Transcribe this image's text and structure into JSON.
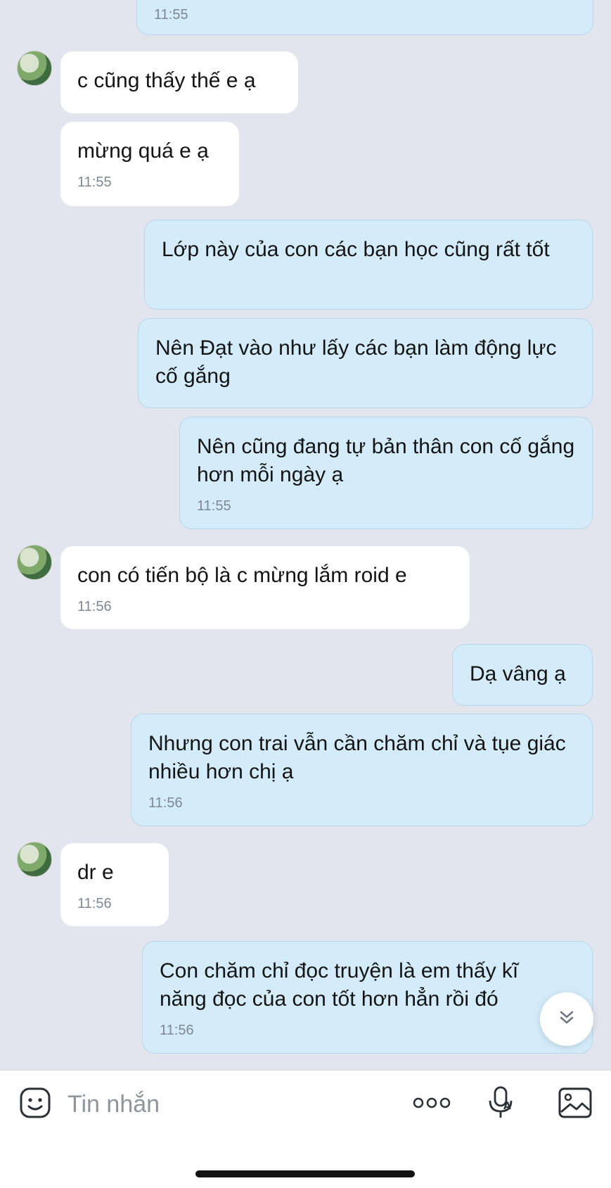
{
  "messages": [
    {
      "side": "out",
      "text": "",
      "time": "11:55"
    },
    {
      "side": "in",
      "text": "c cũng thấy thế e ạ",
      "time": ""
    },
    {
      "side": "in",
      "text": "mừng quá e ạ",
      "time": "11:55"
    },
    {
      "side": "out",
      "text": "Lớp này của con các bạn học cũng rất tốt",
      "time": ""
    },
    {
      "side": "out",
      "text": "Nên Đạt vào như lấy các bạn làm động lực cố gắng",
      "time": ""
    },
    {
      "side": "out",
      "text": "Nên cũng đang tự bản thân con cố gắng hơn mỗi ngày ạ",
      "time": "11:55"
    },
    {
      "side": "in",
      "text": "con có tiến bộ là c mừng lắm roid e",
      "time": "11:56"
    },
    {
      "side": "out",
      "text": "Dạ vâng ạ",
      "time": ""
    },
    {
      "side": "out",
      "text": "Nhưng con trai vẫn cần chăm chỉ và tụe giác nhiều hơn chị ạ",
      "time": "11:56"
    },
    {
      "side": "in",
      "text": "dr e",
      "time": "11:56"
    },
    {
      "side": "out",
      "text": "Con chăm chỉ đọc truyện là em thấy kĩ năng đọc của con tốt hơn hẳn rồi đó",
      "time": "11:56"
    }
  ],
  "input_bar": {
    "placeholder": "Tin nhắn",
    "icons": [
      "sticker-icon",
      "more-icon",
      "voice-to-text-icon",
      "image-icon"
    ]
  },
  "scroll_button": {
    "icon": "chevron-double-down-icon"
  },
  "colors": {
    "incoming_bubble": "#ffffff",
    "outgoing_bubble": "#d4ecfa",
    "background": "#e3e5ee"
  }
}
